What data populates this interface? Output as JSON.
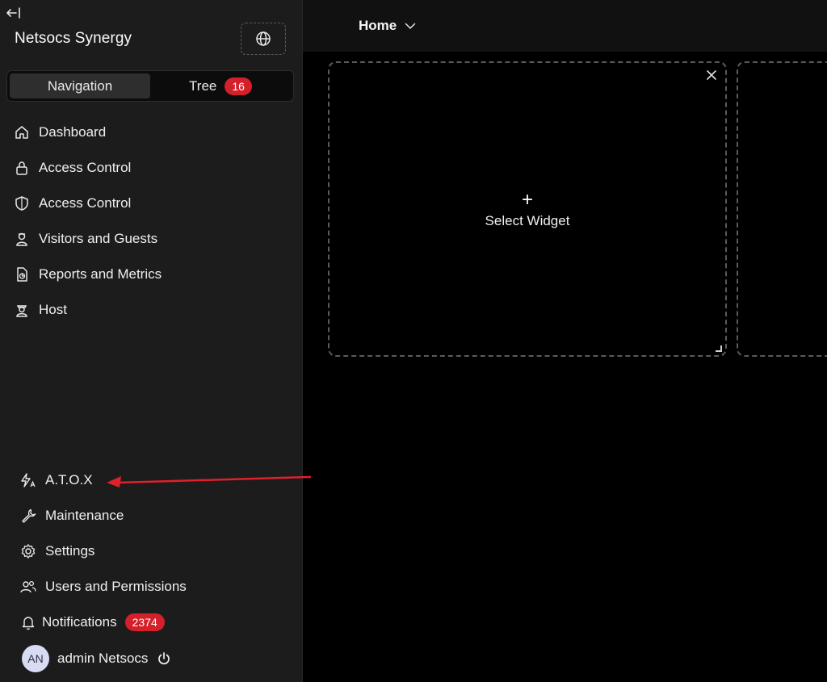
{
  "sidebar": {
    "app_title": "Netsocs Synergy",
    "tabs": [
      {
        "label": "Navigation",
        "active": true
      },
      {
        "label": "Tree",
        "badge": "16"
      }
    ],
    "items": [
      {
        "label": "Dashboard",
        "icon": "home-icon"
      },
      {
        "label": "Access Control",
        "icon": "lock-icon"
      },
      {
        "label": "Access Control",
        "icon": "shield-icon"
      },
      {
        "label": "Visitors and Guests",
        "icon": "visitor-icon"
      },
      {
        "label": "Reports and Metrics",
        "icon": "report-icon"
      },
      {
        "label": "Host",
        "icon": "host-icon"
      }
    ],
    "bottom_items": [
      {
        "label": "A.T.O.X",
        "icon": "atox-icon"
      },
      {
        "label": "Maintenance",
        "icon": "wrench-icon"
      },
      {
        "label": "Settings",
        "icon": "gear-icon"
      },
      {
        "label": "Users and Permissions",
        "icon": "users-icon"
      },
      {
        "label": "Notifications",
        "icon": "bell-icon",
        "badge": "2374"
      }
    ],
    "user": {
      "initials": "AN",
      "name": "admin Netsocs"
    }
  },
  "topbar": {
    "dashboard_select": "Home"
  },
  "widget": {
    "plus": "+",
    "label": "Select Widget"
  },
  "colors": {
    "badge": "#d4202b",
    "annotation_arrow": "#e0202a",
    "sidebar_bg": "#1c1c1c"
  }
}
